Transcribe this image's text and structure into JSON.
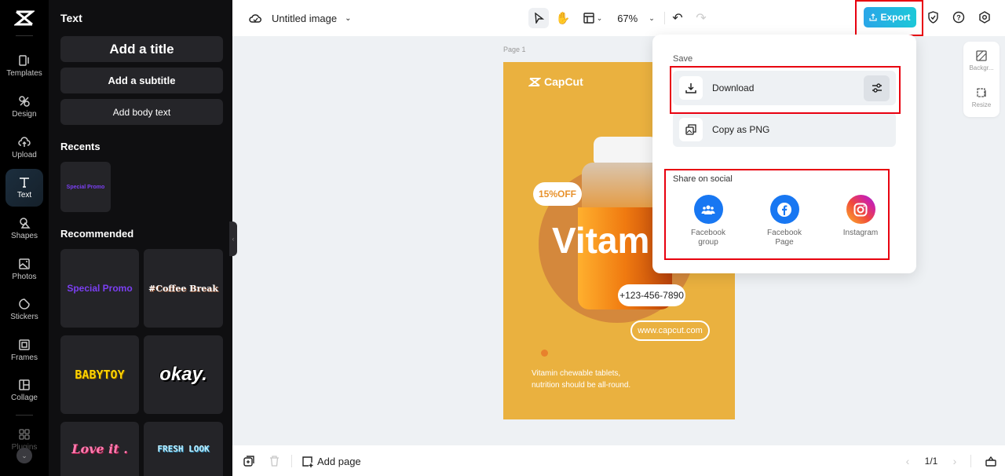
{
  "rail": {
    "items": [
      {
        "label": "Templates",
        "icon": "templates-icon"
      },
      {
        "label": "Design",
        "icon": "design-icon"
      },
      {
        "label": "Upload",
        "icon": "upload-icon"
      },
      {
        "label": "Text",
        "icon": "text-icon",
        "active": true
      },
      {
        "label": "Shapes",
        "icon": "shapes-icon"
      },
      {
        "label": "Photos",
        "icon": "photos-icon"
      },
      {
        "label": "Stickers",
        "icon": "stickers-icon"
      },
      {
        "label": "Frames",
        "icon": "frames-icon"
      },
      {
        "label": "Collage",
        "icon": "collage-icon"
      },
      {
        "label": "Plugins",
        "icon": "plugins-icon"
      }
    ]
  },
  "panel": {
    "title": "Text",
    "add_title": "Add a title",
    "add_subtitle": "Add a subtitle",
    "add_body": "Add body text",
    "recents_label": "Recents",
    "recents": [
      "Special Promo"
    ],
    "recommended_label": "Recommended",
    "recommended": [
      "Special Promo",
      "#Coffee Break",
      "BABYTOY",
      "okay.",
      "Love it .",
      "FRESH LOOK"
    ]
  },
  "topbar": {
    "doc_title": "Untitled image",
    "zoom": "67%",
    "export_label": "Export"
  },
  "canvas": {
    "page_label": "Page 1",
    "poster": {
      "brand": "CapCut",
      "discount": "15%OFF",
      "headline": "Vitam",
      "phone": "+123-456-7890",
      "website": "www.capcut.com",
      "tagline_1": "Vitamin chewable tablets,",
      "tagline_2": "nutrition should be all-round."
    }
  },
  "side_tools": {
    "background": "Backgr...",
    "resize": "Resize"
  },
  "export_popup": {
    "save_label": "Save",
    "download": "Download",
    "copy_png": "Copy as PNG",
    "share_label": "Share on social",
    "social": [
      {
        "line1": "Facebook",
        "line2": "group",
        "color": "#1877f2"
      },
      {
        "line1": "Facebook",
        "line2": "Page",
        "color": "#1877f2"
      },
      {
        "line1": "Instagram",
        "line2": ""
      }
    ]
  },
  "bottombar": {
    "add_page": "Add page",
    "page_counter": "1/1"
  }
}
